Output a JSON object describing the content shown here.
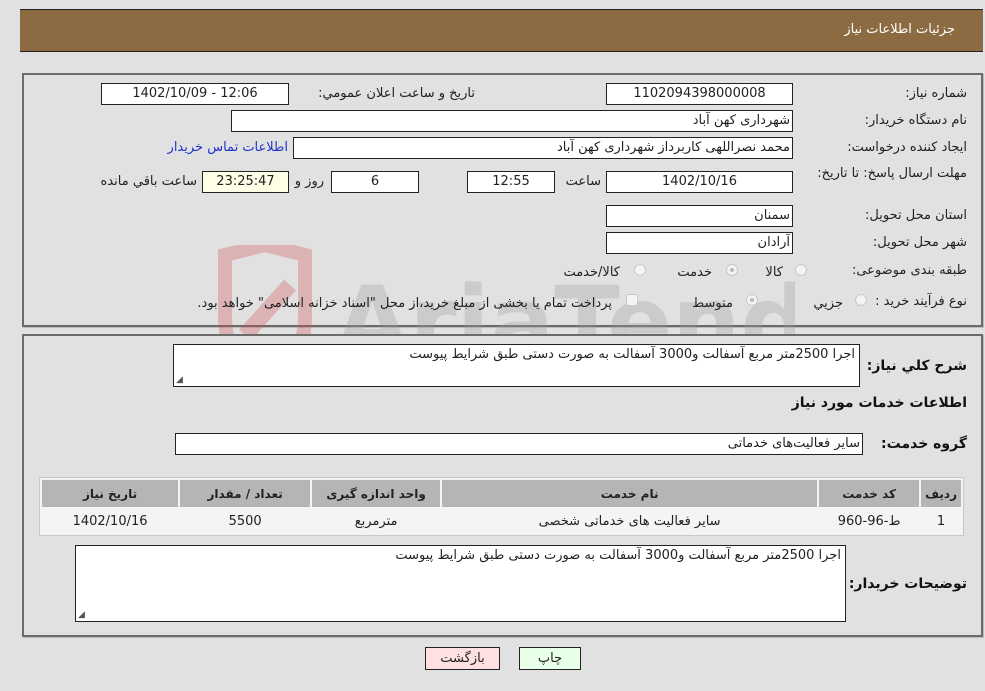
{
  "header": {
    "title": "جزئیات اطلاعات نیاز"
  },
  "details": {
    "need_number_label": "شماره نیاز:",
    "need_number": "1102094398000008",
    "announce_label": "تاریخ و ساعت اعلان عمومي:",
    "announce_value": "1402/10/09 - 12:06",
    "buyer_org_label": "نام دستگاه خریدار:",
    "buyer_org": "شهرداری کهن آباد",
    "creator_label": "ایجاد کننده درخواست:",
    "creator": "محمد نصراللهی کاربرداز شهرداری کهن آباد",
    "contact_link": "اطلاعات تماس خریدار",
    "deadline_label": "مهلت ارسال پاسخ: تا تاریخ:",
    "deadline_date": "1402/10/16",
    "time_label": "ساعت",
    "deadline_time": "12:55",
    "days_value": "6",
    "days_label": "روز و",
    "remaining_time": "23:25:47",
    "remaining_label": "ساعت باقي مانده",
    "province_label": "استان محل تحویل:",
    "province": "سمنان",
    "city_label": "شهر محل تحویل:",
    "city": "آرادان",
    "category_label": "طبقه بندی موضوعی:",
    "category_options": [
      {
        "label": "کالا",
        "checked": false
      },
      {
        "label": "خدمت",
        "checked": true
      },
      {
        "label": "کالا/خدمت",
        "checked": false
      }
    ],
    "process_label": "نوع فرآیند خرید :",
    "process_options": [
      {
        "label": "جزيي",
        "checked": false
      },
      {
        "label": "متوسط",
        "checked": true
      }
    ],
    "treasury_checkbox_checked": false,
    "treasury_note": "پرداخت تمام یا بخشی از مبلغ خرید،از محل \"اسناد خزانه اسلامی\" خواهد بود."
  },
  "services": {
    "description_label": "شرح کلي نیاز:",
    "description": "اجرا 2500متر مربع آسفالت و3000 آسفالت به صورت دستی طبق شرایط پیوست",
    "section_title": "اطلاعات خدمات مورد نیاز",
    "group_label": "گروه خدمت:",
    "group_value": "سایر فعالیت‌های خدماتی",
    "table": {
      "headers": [
        "ردیف",
        "کد خدمت",
        "نام خدمت",
        "واحد اندازه گیری",
        "تعداد / مقدار",
        "تاریخ نیاز"
      ],
      "rows": [
        [
          "1",
          "ط-96-960",
          "سایر فعالیت های خدماتی شخصی",
          "مترمربع",
          "5500",
          "1402/10/16"
        ]
      ]
    },
    "buyer_notes_label": "توضیحات خریدار:",
    "buyer_notes": "اجرا 2500متر مربع آسفالت و3000 آسفالت به صورت دستی طبق شرایط پیوست"
  },
  "buttons": {
    "print": "چاپ",
    "back": "بازگشت"
  },
  "watermark": {
    "text": "AriaTender.neT"
  },
  "colors": {
    "header_bg": "#8c6b43",
    "page_bg": "#e1e1e1",
    "link": "#2233cc",
    "back_button_bg": "#ffe0e0",
    "print_button_bg": "#e8ffe8",
    "remaining_bg": "#ffffe8"
  }
}
